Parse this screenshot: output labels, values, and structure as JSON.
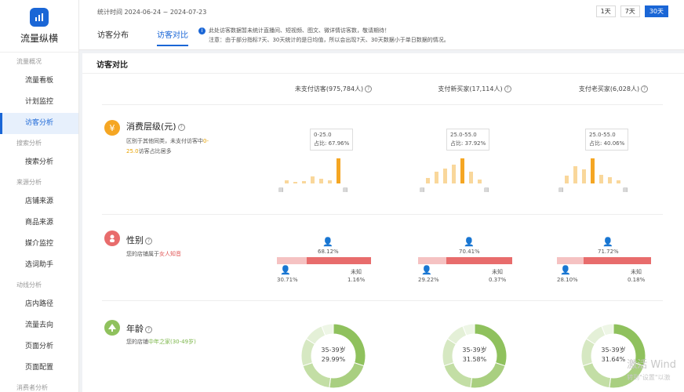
{
  "sidebar": {
    "logo_text": "流量纵横",
    "groups": [
      {
        "label": "流量概况",
        "items": [
          {
            "label": "流量看板",
            "active": false
          },
          {
            "label": "计划监控",
            "active": false
          },
          {
            "label": "访客分析",
            "active": true
          }
        ]
      },
      {
        "label": "搜索分析",
        "items": [
          {
            "label": "搜索分析",
            "active": false
          }
        ]
      },
      {
        "label": "来源分析",
        "items": [
          {
            "label": "店铺来源",
            "active": false
          },
          {
            "label": "商品来源",
            "active": false
          },
          {
            "label": "媒介监控",
            "active": false
          },
          {
            "label": "选词助手",
            "active": false
          }
        ]
      },
      {
        "label": "动线分析",
        "items": [
          {
            "label": "店内路径",
            "active": false
          },
          {
            "label": "流量去向",
            "active": false
          },
          {
            "label": "页面分析",
            "active": false
          },
          {
            "label": "页面配置",
            "active": false
          }
        ]
      },
      {
        "label": "消费者分析",
        "items": []
      }
    ]
  },
  "header": {
    "stat_time": "统计时间 2024-06-24 ~ 2024-07-23",
    "range_buttons": [
      {
        "label": "1天",
        "active": false
      },
      {
        "label": "7天",
        "active": false
      },
      {
        "label": "30天",
        "active": true
      }
    ],
    "tabs": [
      {
        "label": "访客分布",
        "active": false
      },
      {
        "label": "访客对比",
        "active": true
      }
    ],
    "notice_icon": "info-icon",
    "notice_line1": "此处访客数据暂未统计直播间、短视频、图文、微详情访客数，敬请期待！",
    "notice_line2": "注意：由于部分指标7天、30天统计的是日均值，所以会出现7天、30天数据小于单日数据的情况。"
  },
  "section": {
    "title": "访客对比",
    "columns": [
      "未支付访客(975,784人)",
      "支付新买家(17,114人)",
      "支付老买家(6,028人)"
    ]
  },
  "consume": {
    "icon": "yen-icon",
    "title": "消费层级(元)",
    "desc_prefix": "区别于其他同类，未支付访客中",
    "desc_highlight": "0-25.0",
    "desc_suffix": "访客占比居多",
    "charts": [
      {
        "range": "0-25.0",
        "ratio": "占比: 67.96%",
        "values": [
          4,
          2,
          3,
          8,
          6,
          4,
          30
        ],
        "highlight": 6
      },
      {
        "range": "25.0-55.0",
        "ratio": "占比: 37.92%",
        "values": [
          8,
          18,
          22,
          28,
          38,
          18,
          6
        ],
        "highlight": 4
      },
      {
        "range": "25.0-55.0",
        "ratio": "占比: 40.06%",
        "values": [
          12,
          28,
          22,
          40,
          14,
          10,
          5
        ],
        "highlight": 3
      }
    ]
  },
  "gender": {
    "icon": "gender-icon",
    "title": "性别",
    "desc_prefix": "您的店铺属于",
    "desc_highlight": "女人知音",
    "charts": [
      {
        "female": "30.71%",
        "male": "68.12%",
        "unknown_label": "未知",
        "unknown": "1.16%",
        "male_frac": 0.6812
      },
      {
        "female": "29.22%",
        "male": "70.41%",
        "unknown_label": "未知",
        "unknown": "0.37%",
        "male_frac": 0.7041
      },
      {
        "female": "28.10%",
        "male": "71.72%",
        "unknown_label": "未知",
        "unknown": "0.18%",
        "male_frac": 0.7172
      }
    ]
  },
  "age": {
    "icon": "tree-icon",
    "title": "年龄",
    "desc_prefix": "您的店铺",
    "desc_highlight": "中年之家(30-49岁)",
    "charts": [
      {
        "label": "35-39岁",
        "value": "29.99%"
      },
      {
        "label": "35-39岁",
        "value": "31.58%"
      },
      {
        "label": "35-39岁",
        "value": "31.64%"
      }
    ]
  },
  "watermark": {
    "line1": "激活 Wind",
    "line2": "转到\"设置\"以激"
  },
  "colors": {
    "accent": "#1a66d6",
    "orange": "#f5a623",
    "gender_male": "#e86c6c",
    "gender_female": "#f5c2c2",
    "age_green": "#8fc15d"
  }
}
